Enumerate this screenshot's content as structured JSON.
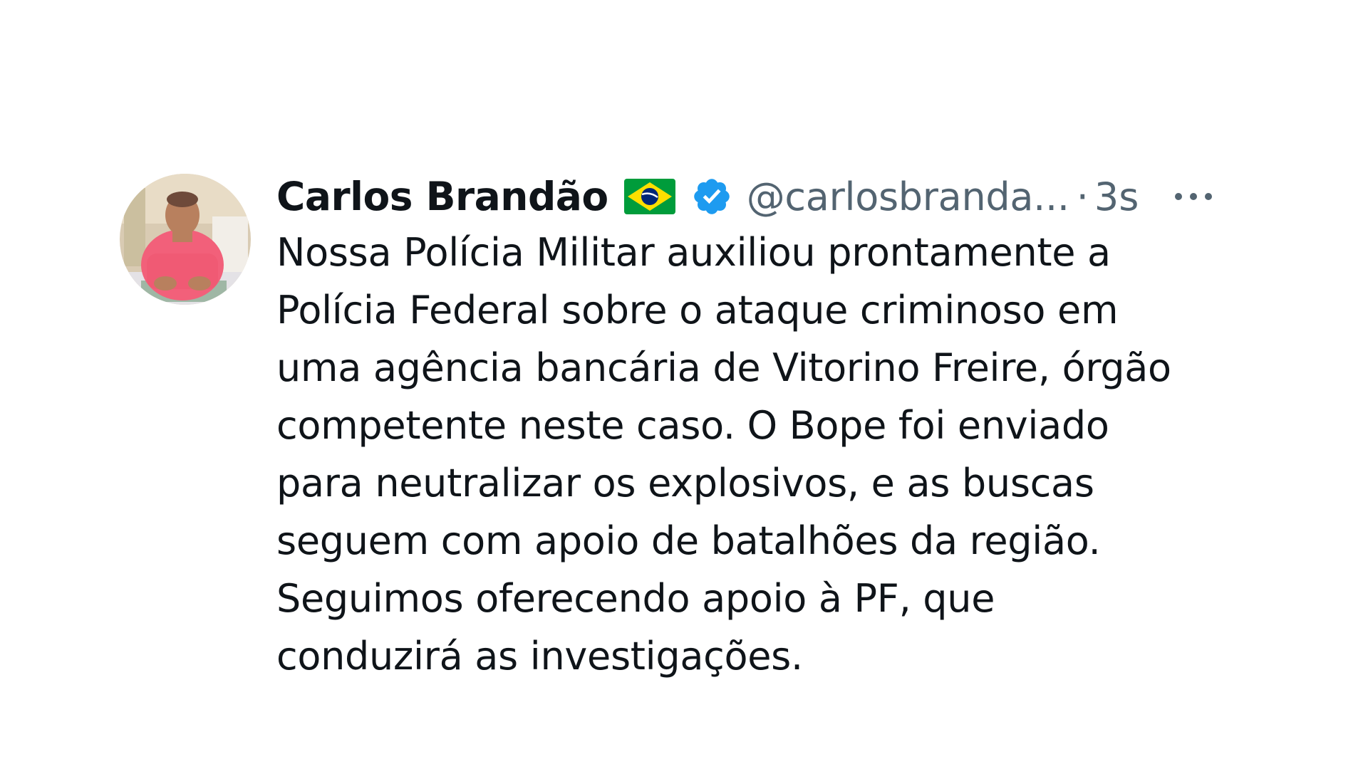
{
  "tweet": {
    "author_name": "Carlos Brandão",
    "flag_emoji": "brazil-flag-icon",
    "verified_badge": "verified-badge-icon",
    "handle": "@carlosbranda...",
    "separator": "·",
    "time": "3s",
    "more_icon": "more-options-icon",
    "body_lines": [
      "Nossa Polícia Militar auxiliou prontamente a",
      "Polícia Federal sobre o ataque criminoso em",
      "uma agência bancária de Vitorino Freire, órgão",
      "competente neste caso. O Bope foi enviado",
      "para neutralizar os explosivos, e as buscas",
      "seguem com apoio de batalhões da região.",
      "Seguimos oferecendo apoio à PF, que",
      "conduzirá as investigações."
    ]
  },
  "colors": {
    "text_primary": "#0f1419",
    "text_secondary": "#536471",
    "verified_blue": "#1d9bf0",
    "flag_green": "#009c3b",
    "flag_yellow": "#ffdf00",
    "flag_blue": "#002776"
  }
}
